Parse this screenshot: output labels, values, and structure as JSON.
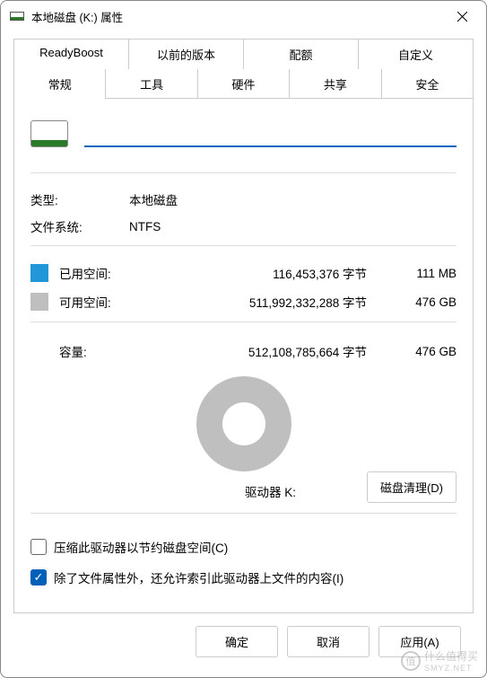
{
  "window": {
    "title": "本地磁盘 (K:) 属性"
  },
  "tabs": {
    "row1": [
      "ReadyBoost",
      "以前的版本",
      "配额",
      "自定义"
    ],
    "row2": [
      "常规",
      "工具",
      "硬件",
      "共享",
      "安全"
    ],
    "active": "常规"
  },
  "drive": {
    "name_value": "",
    "type_label": "类型:",
    "type_value": "本地磁盘",
    "fs_label": "文件系统:",
    "fs_value": "NTFS"
  },
  "space": {
    "used_label": "已用空间:",
    "used_bytes": "116,453,376 字节",
    "used_hr": "111 MB",
    "free_label": "可用空间:",
    "free_bytes": "511,992,332,288 字节",
    "free_hr": "476 GB",
    "cap_label": "容量:",
    "cap_bytes": "512,108,785,664 字节",
    "cap_hr": "476 GB"
  },
  "driveline": {
    "label": "驱动器 K:",
    "cleanup": "磁盘清理(D)"
  },
  "checks": {
    "compress": {
      "checked": false,
      "label": "压缩此驱动器以节约磁盘空间(C)"
    },
    "index": {
      "checked": true,
      "label": "除了文件属性外，还允许索引此驱动器上文件的内容(I)"
    }
  },
  "buttons": {
    "ok": "确定",
    "cancel": "取消",
    "apply": "应用(A)"
  },
  "watermark": {
    "brand": "值",
    "text1": "什么值得买",
    "text2": "SMYZ.NET"
  }
}
